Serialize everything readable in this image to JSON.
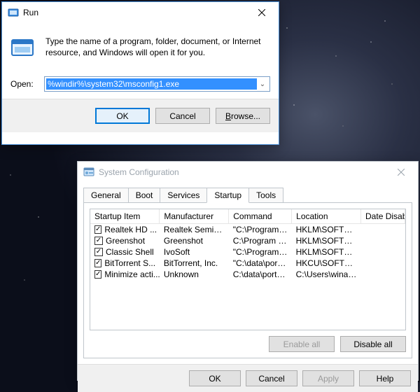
{
  "run": {
    "title": "Run",
    "description": "Type the name of a program, folder, document, or Internet resource, and Windows will open it for you.",
    "open_label": "Open:",
    "open_value": "%windir%\\system32\\msconfig1.exe",
    "buttons": {
      "ok": "OK",
      "cancel": "Cancel",
      "browse_prefix": "B",
      "browse_rest": "rowse..."
    }
  },
  "sysconfig": {
    "title": "System Configuration",
    "tabs": [
      "General",
      "Boot",
      "Services",
      "Startup",
      "Tools"
    ],
    "active_tab": "Startup",
    "columns": [
      "Startup Item",
      "Manufacturer",
      "Command",
      "Location",
      "Date Disabled"
    ],
    "rows": [
      {
        "checked": true,
        "item": "Realtek HD ...",
        "manufacturer": "Realtek Semico...",
        "command": "\"C:\\Program Fil...",
        "location": "HKLM\\SOFTWARE\\M...",
        "date_disabled": ""
      },
      {
        "checked": true,
        "item": "Greenshot",
        "manufacturer": "Greenshot",
        "command": "C:\\Program Fil...",
        "location": "HKLM\\SOFTWARE\\M...",
        "date_disabled": ""
      },
      {
        "checked": true,
        "item": "Classic Shell",
        "manufacturer": "IvoSoft",
        "command": "\"C:\\Program Fil...",
        "location": "HKLM\\SOFTWARE\\M...",
        "date_disabled": ""
      },
      {
        "checked": true,
        "item": "BitTorrent S...",
        "manufacturer": "BitTorrent, Inc.",
        "command": "\"C:\\data\\porta...",
        "location": "HKCU\\SOFTWARE\\M...",
        "date_disabled": ""
      },
      {
        "checked": true,
        "item": "Minimize acti...",
        "manufacturer": "Unknown",
        "command": "C:\\data\\portab...",
        "location": "C:\\Users\\winaero\\A...",
        "date_disabled": ""
      }
    ],
    "buttons": {
      "enable_all": "Enable all",
      "disable_all": "Disable all",
      "ok": "OK",
      "cancel": "Cancel",
      "apply": "Apply",
      "help": "Help"
    }
  }
}
